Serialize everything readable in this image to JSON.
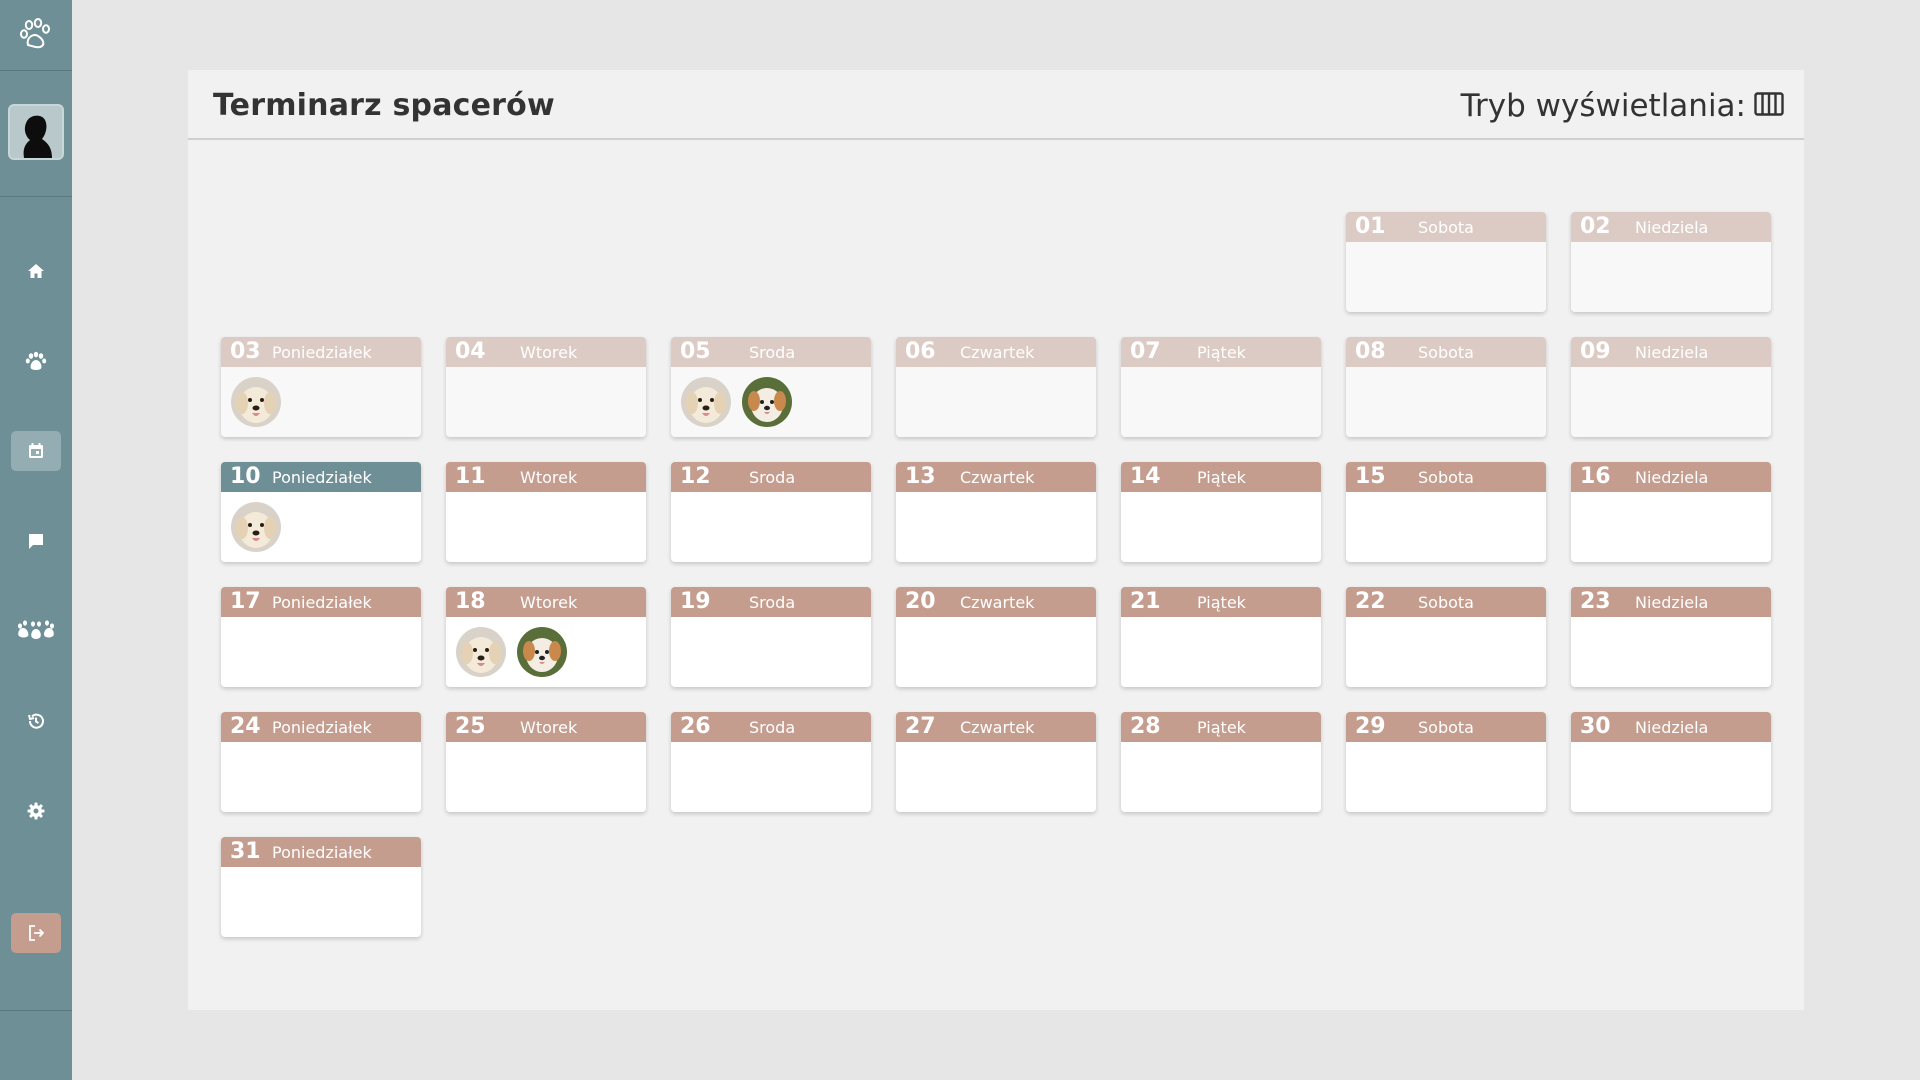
{
  "app": {
    "title": "Terminarz spacerów",
    "view_mode_label": "Tryb wyświetlania:"
  },
  "sidebar": {
    "items": [
      {
        "name": "home",
        "icon": "home-icon",
        "active": false
      },
      {
        "name": "pets",
        "icon": "paw-icon",
        "active": false
      },
      {
        "name": "calendar",
        "icon": "calendar-icon",
        "active": true
      },
      {
        "name": "messages",
        "icon": "chat-icon",
        "active": false
      },
      {
        "name": "dogs",
        "icon": "paws-group-icon",
        "active": false
      },
      {
        "name": "history",
        "icon": "history-icon",
        "active": false
      },
      {
        "name": "settings",
        "icon": "gear-icon",
        "active": false
      }
    ],
    "logout_icon": "logout-icon"
  },
  "colors": {
    "sidebar": "#6e8f96",
    "accent": "#c49d8f",
    "accent_past": "#dccbc4",
    "today": "#6e8f96"
  },
  "calendar": {
    "days": [
      {
        "num": "01",
        "name": "Sobota",
        "state": "past",
        "dogs": []
      },
      {
        "num": "02",
        "name": "Niedziela",
        "state": "past",
        "dogs": []
      },
      {
        "num": "03",
        "name": "Poniedziałek",
        "state": "past",
        "dogs": [
          "golden-retriever"
        ]
      },
      {
        "num": "04",
        "name": "Wtorek",
        "state": "past",
        "dogs": []
      },
      {
        "num": "05",
        "name": "Sroda",
        "state": "past",
        "dogs": [
          "golden-retriever",
          "maltipoo"
        ]
      },
      {
        "num": "06",
        "name": "Czwartek",
        "state": "past",
        "dogs": []
      },
      {
        "num": "07",
        "name": "Piątek",
        "state": "past",
        "dogs": []
      },
      {
        "num": "08",
        "name": "Sobota",
        "state": "past",
        "dogs": []
      },
      {
        "num": "09",
        "name": "Niedziela",
        "state": "past",
        "dogs": []
      },
      {
        "num": "10",
        "name": "Poniedziałek",
        "state": "today",
        "dogs": [
          "golden-retriever"
        ]
      },
      {
        "num": "11",
        "name": "Wtorek",
        "state": "future",
        "dogs": []
      },
      {
        "num": "12",
        "name": "Sroda",
        "state": "future",
        "dogs": []
      },
      {
        "num": "13",
        "name": "Czwartek",
        "state": "future",
        "dogs": []
      },
      {
        "num": "14",
        "name": "Piątek",
        "state": "future",
        "dogs": []
      },
      {
        "num": "15",
        "name": "Sobota",
        "state": "future",
        "dogs": []
      },
      {
        "num": "16",
        "name": "Niedziela",
        "state": "future",
        "dogs": []
      },
      {
        "num": "17",
        "name": "Poniedziałek",
        "state": "future",
        "dogs": []
      },
      {
        "num": "18",
        "name": "Wtorek",
        "state": "future",
        "dogs": [
          "golden-retriever",
          "maltipoo"
        ]
      },
      {
        "num": "19",
        "name": "Sroda",
        "state": "future",
        "dogs": []
      },
      {
        "num": "20",
        "name": "Czwartek",
        "state": "future",
        "dogs": []
      },
      {
        "num": "21",
        "name": "Piątek",
        "state": "future",
        "dogs": []
      },
      {
        "num": "22",
        "name": "Sobota",
        "state": "future",
        "dogs": []
      },
      {
        "num": "23",
        "name": "Niedziela",
        "state": "future",
        "dogs": []
      },
      {
        "num": "24",
        "name": "Poniedziałek",
        "state": "future",
        "dogs": []
      },
      {
        "num": "25",
        "name": "Wtorek",
        "state": "future",
        "dogs": []
      },
      {
        "num": "26",
        "name": "Sroda",
        "state": "future",
        "dogs": []
      },
      {
        "num": "27",
        "name": "Czwartek",
        "state": "future",
        "dogs": []
      },
      {
        "num": "28",
        "name": "Piątek",
        "state": "future",
        "dogs": []
      },
      {
        "num": "29",
        "name": "Sobota",
        "state": "future",
        "dogs": []
      },
      {
        "num": "30",
        "name": "Niedziela",
        "state": "future",
        "dogs": []
      },
      {
        "num": "31",
        "name": "Poniedziałek",
        "state": "future",
        "dogs": []
      }
    ]
  }
}
